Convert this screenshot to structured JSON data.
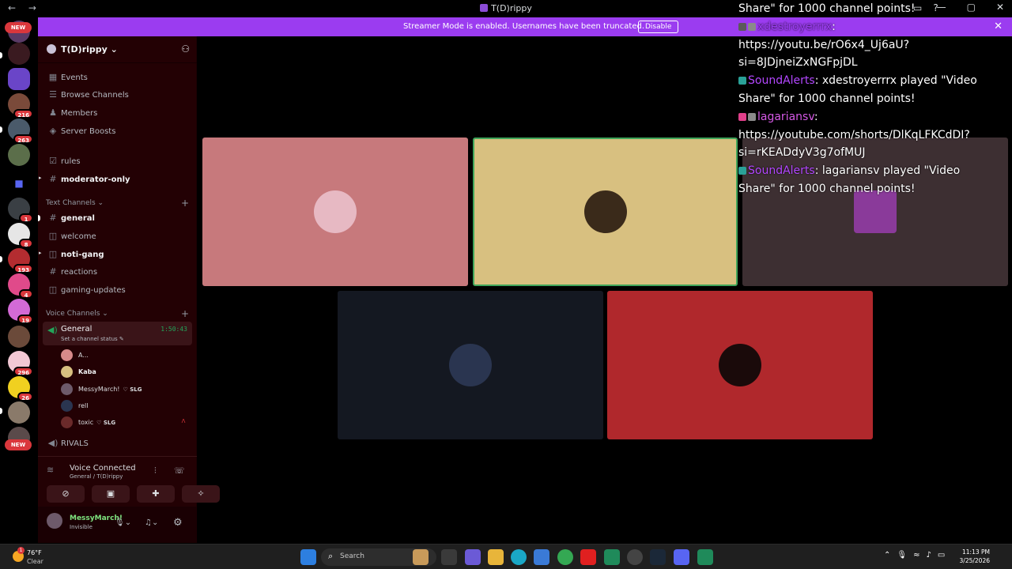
{
  "window": {
    "title": "T(D)rippy",
    "nav": "← →"
  },
  "banner": {
    "text": "Streamer Mode is enabled. Usernames have been truncated.",
    "button": "Disable"
  },
  "guild_rail": {
    "new_top": "NEW",
    "new_bottom": "NEW",
    "badges": [
      "216",
      "263",
      "1",
      "8",
      "193",
      "4",
      "19",
      "296",
      "26"
    ]
  },
  "server": {
    "name": "T(D)rippy ⌄"
  },
  "channels": {
    "top_items": [
      {
        "label": "Events"
      },
      {
        "label": "Browse Channels"
      },
      {
        "label": "Members"
      },
      {
        "label": "Server Boosts"
      }
    ],
    "rules": "rules",
    "moderator": "moderator-only",
    "text_category": "Text Channels ⌄",
    "text_channels": [
      "general",
      "welcome",
      "noti-gang",
      "reactions",
      "gaming-updates"
    ],
    "voice_category": "Voice Channels ⌄",
    "voice_general": {
      "name": "General",
      "timer": "1:50:43",
      "status": "Set a channel status ✎"
    },
    "voice_users": [
      {
        "name": "A...",
        "tag": ""
      },
      {
        "name": "Kaba",
        "tag": ""
      },
      {
        "name": "MessyMarch!",
        "tag": "♡ SLG"
      },
      {
        "name": "rell",
        "tag": ""
      },
      {
        "name": "toxic",
        "tag": "♡ SLG"
      }
    ],
    "rivals": "RIVALS"
  },
  "voice_panel": {
    "title": "Voice Connected",
    "subtitle": "General / T(D)rippy"
  },
  "user": {
    "name": "MessyMarch!",
    "status": "Invisible"
  },
  "chat": {
    "l1": "Share\" for 1000 channel points!",
    "l2_user": "xdestroyerrrx",
    "l2_sep": ":",
    "l3": "https://youtu.be/rO6x4_Uj6aU?",
    "l4": "si=8JDjneiZxNGFpjDL",
    "l5_user": "SoundAlerts",
    "l5_rest": ": xdestroyerrrx played \"Video",
    "l6": "Share\" for 1000 channel points!",
    "l7_user": "lagariansv",
    "l7_sep": ":",
    "l8": "https://youtube.com/shorts/DlKqLFKCdDI?",
    "l9": "si=rKEADdyV3g7ofMUJ",
    "l10_user": "SoundAlerts",
    "l10_rest": ": lagariansv played \"Video",
    "l11": "Share\" for 1000 channel points!"
  },
  "taskbar": {
    "temp": "76°F",
    "cond": "Clear",
    "weather_badge": "1",
    "search": "Search",
    "time": "11:13 PM",
    "date": "3/25/2026"
  },
  "colors": {
    "banner": "#9b3cf0",
    "sidebar": "#230104",
    "tile1": "#c7797c",
    "tile2": "#d8c080",
    "tile3": "#3d2f32",
    "tile4": "#141821",
    "tile5": "#b0282c"
  }
}
